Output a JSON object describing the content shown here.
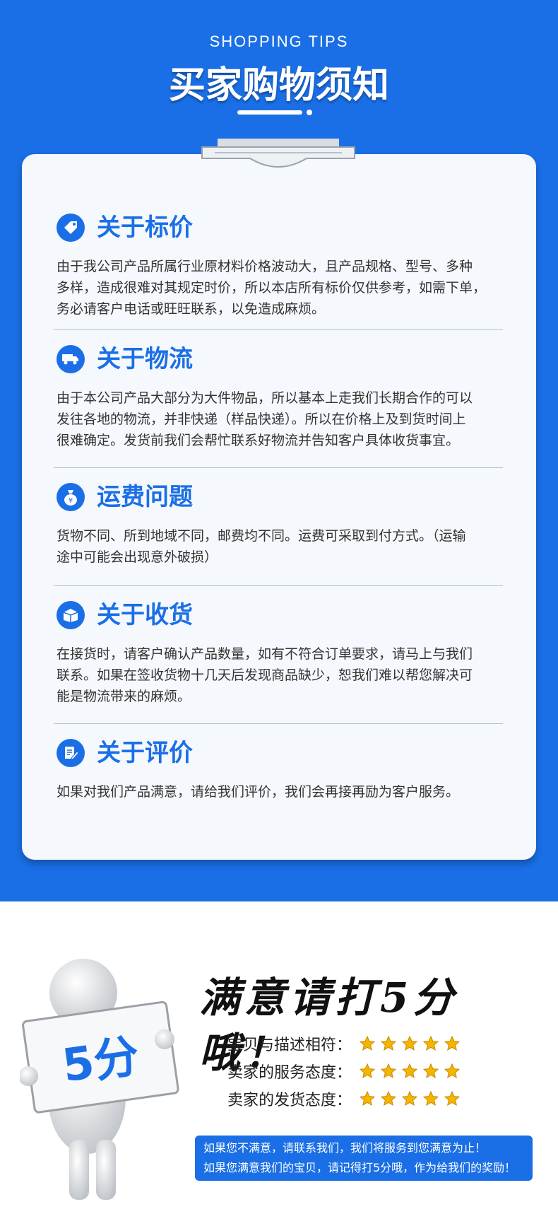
{
  "header": {
    "kicker": "SHOPPING TIPS",
    "title": "买家购物须知"
  },
  "colors": {
    "brand_blue": "#1a6fe6",
    "card_bg": "#f5f8fc",
    "star": "#f5b400"
  },
  "sections": [
    {
      "icon": "price-tag-icon",
      "title": "关于标价",
      "lines": [
        "由于我公司产品所属行业原材料价格波动大，且产品规格、型号、多种",
        "多样，造成很难对其规定时价，所以本店所有标价仅供参考，如需下单，",
        "务必请客户电话或旺旺联系，以免造成麻烦。"
      ]
    },
    {
      "icon": "truck-icon",
      "title": "关于物流",
      "lines": [
        "由于本公司产品大部分为大件物品，所以基本上走我们长期合作的可以",
        "发往各地的物流，并非快递（样品快递）。所以在价格上及到货时间上",
        "很难确定。发货前我们会帮忙联系好物流并告知客户具体收货事宜。"
      ]
    },
    {
      "icon": "money-bag-icon",
      "title": "运费问题",
      "lines": [
        "货物不同、所到地域不同，邮费均不同。运费可采取到付方式。（运输",
        "途中可能会出现意外破损）"
      ]
    },
    {
      "icon": "package-icon",
      "title": "关于收货",
      "lines": [
        "在接货时，请客户确认产品数量，如有不符合订单要求，请马上与我们",
        "联系。如果在签收货物十几天后发现商品缺少，恕我们难以帮您解决可",
        "能是物流带来的麻烦。"
      ]
    },
    {
      "icon": "review-edit-icon",
      "title": "关于评价",
      "lines": [
        "如果对我们产品满意，请给我们评价，我们会再接再励为客户服务。"
      ]
    }
  ],
  "rating": {
    "figure_sign_text": "5分",
    "slogan": "满意请打5分哦！",
    "rows": [
      {
        "label": "宝贝与描述相符：",
        "stars": 5
      },
      {
        "label": "卖家的服务态度：",
        "stars": 5
      },
      {
        "label": "卖家的发货态度：",
        "stars": 5
      }
    ],
    "notice_lines": [
      "如果您不满意，请联系我们，我们将服务到您满意为止！",
      "如果您满意我们的宝贝，请记得打5分哦，作为给我们的奖励！"
    ]
  }
}
